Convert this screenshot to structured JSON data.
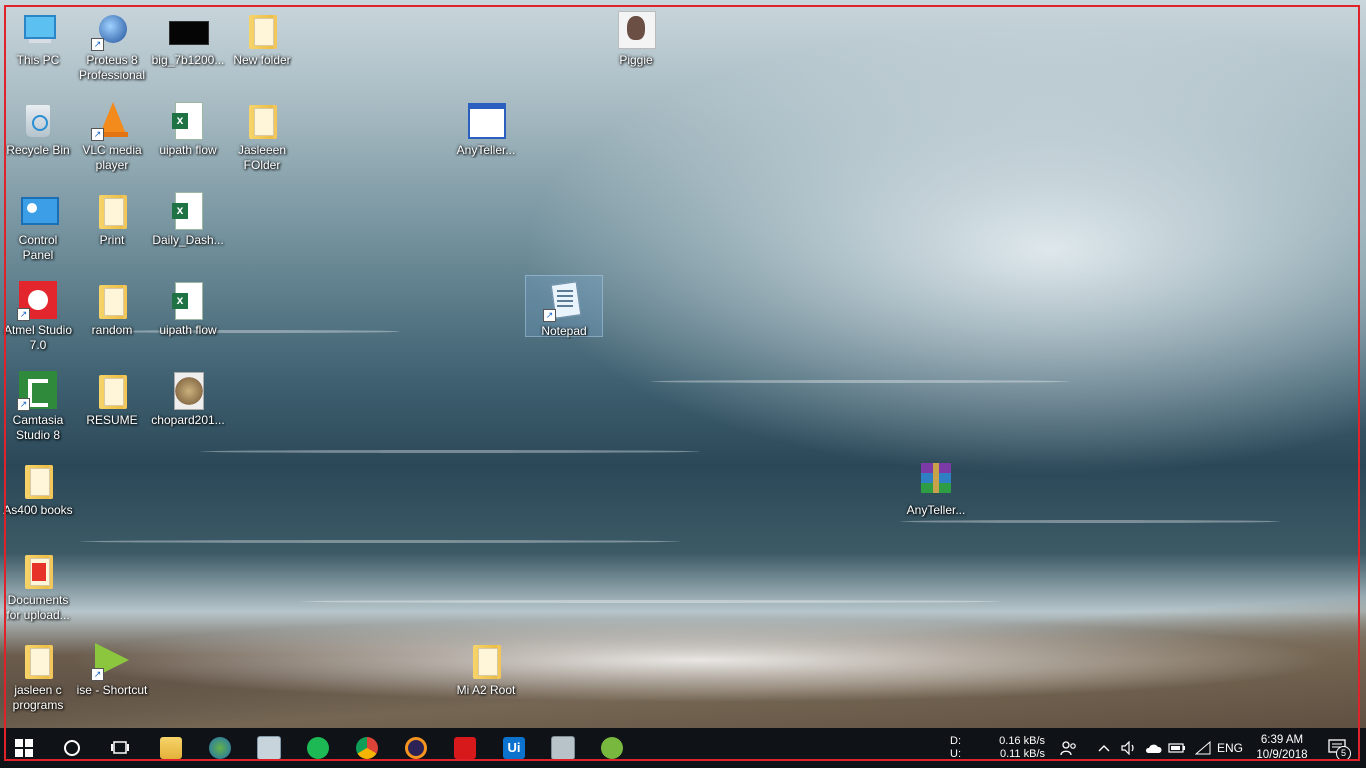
{
  "desktop_icons": {
    "this_pc": "This PC",
    "proteus_1": "Proteus 8",
    "proteus_2": "Professional",
    "big_file": "big_7b1200...",
    "new_folder": "New folder",
    "piggie": "Piggie",
    "recycle_bin": "Recycle Bin",
    "vlc_1": "VLC media",
    "vlc_2": "player",
    "uipath_flow": "uipath flow",
    "jasleen_folder_1": "Jasleeen",
    "jasleen_folder_2": "FOlder",
    "anyteller_1": "AnyTeller...",
    "control_panel_1": "Control",
    "control_panel_2": "Panel",
    "print": "Print",
    "daily_dash": "Daily_Dash...",
    "atmel_1": "Atmel Studio",
    "atmel_2": "7.0",
    "random": "random",
    "uipath_flow_2": "uipath flow",
    "notepad": "Notepad",
    "camtasia_1": "Camtasia",
    "camtasia_2": "Studio 8",
    "resume": "RESUME",
    "chopard": "chopard201...",
    "as400": "As400 books",
    "anyteller_2": "AnyTeller...",
    "documents_1": "Documents",
    "documents_2": "for upload...",
    "jasleen_c_1": "jasleen c",
    "jasleen_c_2": "programs",
    "ise": "ise - Shortcut",
    "mi_a2": "Mi A2 Root"
  },
  "taskbar": {
    "net_d_label": "D:",
    "net_u_label": "U:",
    "net_d_value": "0.16 kB/s",
    "net_u_value": "0.11 kB/s",
    "language": "ENG",
    "time": "6:39 AM",
    "date": "10/9/2018",
    "notification_count": "5"
  },
  "colors": {
    "taskbar_bg": "#0f1216",
    "frame_border": "#e0232a"
  }
}
